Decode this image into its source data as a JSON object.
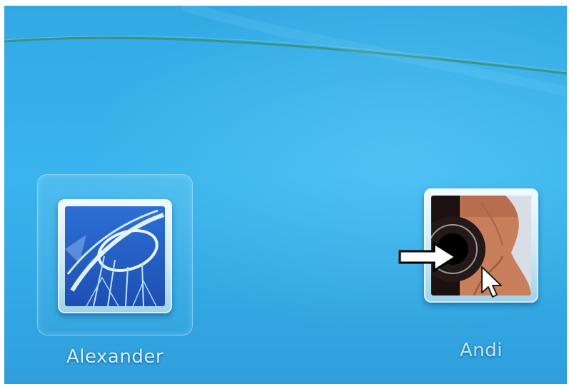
{
  "users": [
    {
      "name": "Alexander",
      "picture": "roller-coaster"
    },
    {
      "name": "Andi",
      "picture": "guitar"
    }
  ],
  "colors": {
    "desktop_background": "#33a9e4",
    "label_text": "#d6effc",
    "frame": "#e6f5fc",
    "annotation_arrow": "#ffffff"
  },
  "icons": [
    "annotation-arrow-icon",
    "mouse-pointer-icon"
  ]
}
